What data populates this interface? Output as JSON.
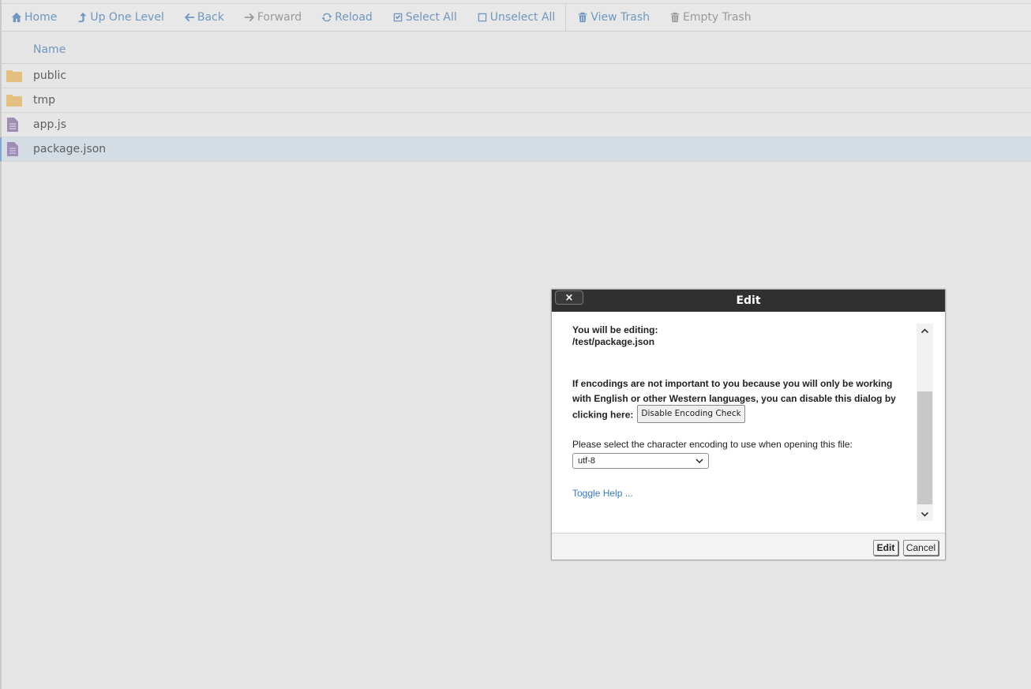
{
  "toolbar": {
    "home": "Home",
    "up_one_level": "Up One Level",
    "back": "Back",
    "forward": "Forward",
    "reload": "Reload",
    "select_all": "Select All",
    "unselect_all": "Unselect All",
    "view_trash": "View Trash",
    "empty_trash": "Empty Trash"
  },
  "filelist": {
    "header_name": "Name",
    "rows": [
      {
        "name": "public",
        "type": "folder"
      },
      {
        "name": "tmp",
        "type": "folder"
      },
      {
        "name": "app.js",
        "type": "file"
      },
      {
        "name": "package.json",
        "type": "file",
        "selected": true
      }
    ]
  },
  "dialog": {
    "title": "Edit",
    "close": "×",
    "editing_label": "You will be editing:",
    "editing_path": "/test/package.json",
    "encoding_note": "If encodings are not important to you because you will only be working with English or other Western languages, you can disable this dialog by clicking here:",
    "disable_button": "Disable Encoding Check",
    "select_label": "Please select the character encoding to use when opening this file:",
    "encoding_value": "utf-8",
    "toggle_help": "Toggle Help ...",
    "edit_button": "Edit",
    "cancel_button": "Cancel"
  },
  "colors": {
    "link": "#6f97bf",
    "folder": "#e3bf80",
    "file": "#a08db5",
    "selected_row": "#d4dde3",
    "title_bar": "#303030"
  }
}
